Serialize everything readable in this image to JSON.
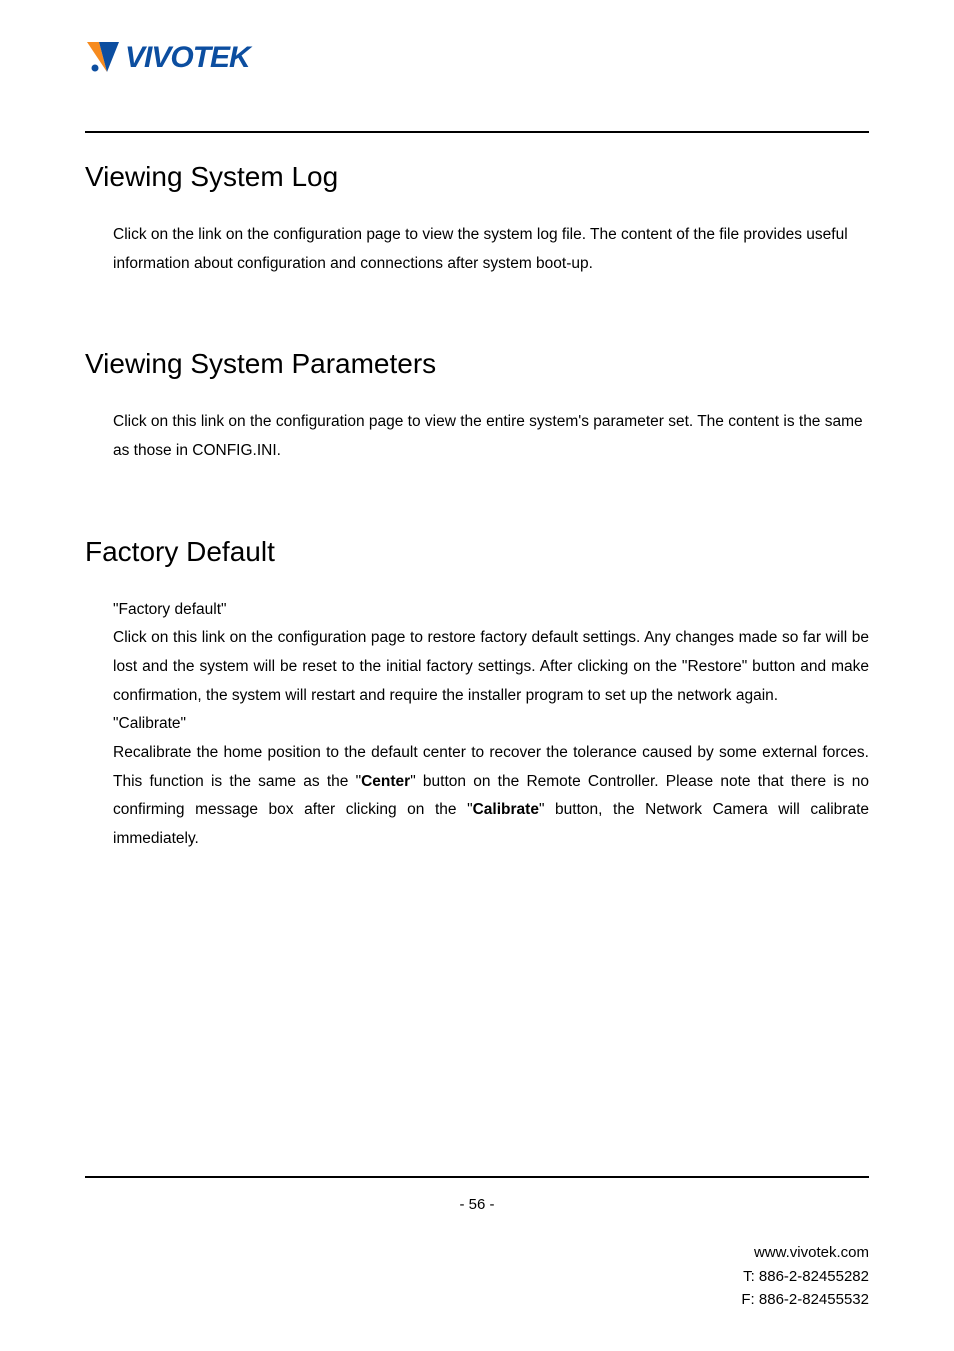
{
  "logo": {
    "brand_text": "VIVOTEK"
  },
  "sections": {
    "s1": {
      "heading": "Viewing System Log",
      "body": "Click on the link on the configuration page to view the system log file. The content of the file provides useful information about configuration and connections after system boot-up."
    },
    "s2": {
      "heading": "Viewing System Parameters",
      "body": "Click on this link on the configuration page to view the entire system's parameter set. The content is the same as those in CONFIG.INI."
    },
    "s3": {
      "heading": "Factory Default",
      "p1_label": "\"Factory default\"",
      "p1_body": "Click on this link on the configuration page to restore factory default settings. Any changes made so far will be lost and the system will be reset to the initial factory settings.  After clicking on the \"Restore\" button and make confirmation, the system will restart and require the installer program to set up the network again.",
      "p2_label": "\"Calibrate\"",
      "p2_body_pre": "Recalibrate the home position to the default center to recover the tolerance caused by some external forces. This function is the same as the \"",
      "p2_bold1": "Center",
      "p2_body_mid": "\" button on the Remote Controller. Please note that there is no confirming message box after clicking on the \"",
      "p2_bold2": "Calibrate",
      "p2_body_post": "\" button, the Network Camera will calibrate immediately."
    }
  },
  "footer": {
    "page_number": "- 56 -",
    "website": "www.vivotek.com",
    "tel": "T: 886-2-82455282",
    "fax": "F: 886-2-82455532"
  }
}
